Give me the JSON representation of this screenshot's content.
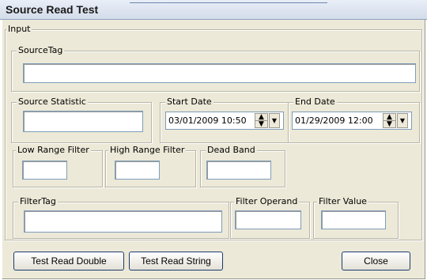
{
  "window": {
    "title": "Source Read Test"
  },
  "input_group": {
    "label": "Input"
  },
  "source_tag": {
    "label": "SourceTag",
    "value": ""
  },
  "source_statistic": {
    "label": "Source Statistic",
    "value": ""
  },
  "start_date": {
    "label": "Start Date",
    "value": "03/01/2009 10:50"
  },
  "end_date": {
    "label": "End Date",
    "value": "01/29/2009 12:00"
  },
  "low_range_filter": {
    "label": "Low Range Filter",
    "value": ""
  },
  "high_range_filter": {
    "label": "High Range Filter",
    "value": ""
  },
  "dead_band": {
    "label": "Dead Band",
    "value": ""
  },
  "filter_tag": {
    "label": "FilterTag",
    "value": ""
  },
  "filter_operand": {
    "label": "Filter Operand",
    "value": ""
  },
  "filter_value": {
    "label": "Filter Value",
    "value": ""
  },
  "buttons": {
    "test_read_double": "Test Read Double",
    "test_read_string": "Test Read String",
    "close": "Close"
  },
  "icons": {
    "spin_up": "▲",
    "spin_down": "▼",
    "dropdown": "▼"
  }
}
